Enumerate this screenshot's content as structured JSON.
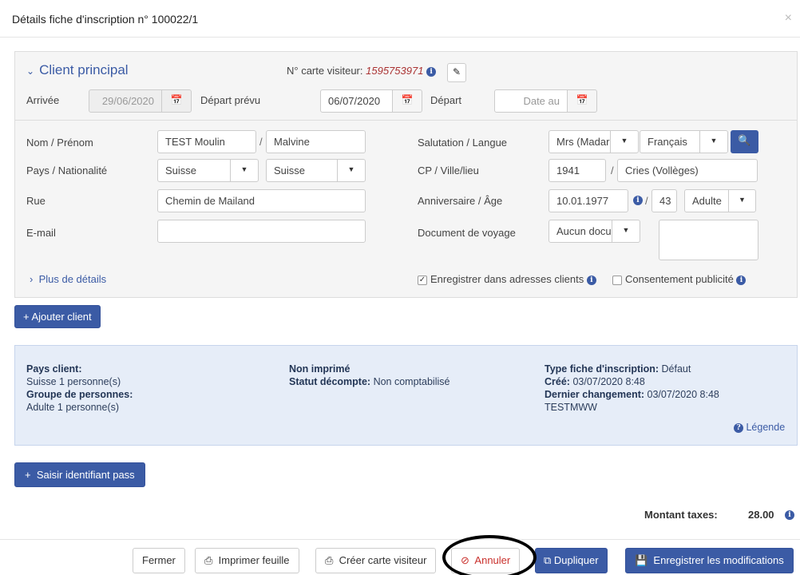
{
  "modal": {
    "title": "Détails fiche d'inscription n° 100022/1",
    "close": "×"
  },
  "client": {
    "section_title": "Client principal",
    "visitor_card_label": "N° carte visiteur:",
    "visitor_card_number": "1595753971",
    "arrival_label": "Arrivée",
    "arrival_value": "29/06/2020",
    "planned_departure_label": "Départ prévu",
    "planned_departure_value": "06/07/2020",
    "departure_label": "Départ",
    "departure_placeholder": "Date au",
    "name_label": "Nom / Prénom",
    "last_name": "TEST Moulin",
    "first_name": "Malvine",
    "country_label": "Pays / Nationalité",
    "country": "Suisse",
    "nationality": "Suisse",
    "street_label": "Rue",
    "street": "Chemin de Mailand",
    "email_label": "E-mail",
    "email": "",
    "salutation_label": "Salutation / Langue",
    "salutation": "Mrs (Madar",
    "language": "Français",
    "zip_label": "CP / Ville/lieu",
    "zip": "1941",
    "city": "Cries (Vollèges)",
    "birthday_label": "Anniversaire / Âge",
    "birthday": "10.01.1977",
    "age": "43",
    "age_category": "Adulte",
    "travel_doc_label": "Document de voyage",
    "travel_doc": "Aucun docum",
    "separator": "/",
    "more_details": "Plus de détails",
    "save_addresses_label": "Enregistrer dans adresses clients",
    "save_addresses_checked": true,
    "consent_label": "Consentement publicité",
    "consent_checked": false
  },
  "add_client_button": "Ajouter client",
  "summary": {
    "country_client_label": "Pays client:",
    "country_client_value": "Suisse 1 personne(s)",
    "group_label": "Groupe de personnes:",
    "group_value": "Adulte 1 personne(s)",
    "print_status": "Non imprimé",
    "count_status_label": "Statut décompte:",
    "count_status_value": "Non comptabilisé",
    "type_label": "Type fiche d'inscription:",
    "type_value": "Défaut",
    "created_label": "Créé:",
    "created_value": "03/07/2020 8:48",
    "last_change_label": "Dernier changement:",
    "last_change_value": "03/07/2020 8:48",
    "user": "TESTMWW",
    "legend": "Légende"
  },
  "pass_button": "Saisir identifiant pass",
  "tax": {
    "label": "Montant taxes:",
    "value": "28.00"
  },
  "footer": {
    "close": "Fermer",
    "print": "Imprimer feuille",
    "create_card": "Créer carte visiteur",
    "cancel": "Annuler",
    "duplicate": "Dupliquer",
    "save": "Enregistrer les modifications"
  },
  "colors": {
    "primary": "#3b5ba5",
    "danger": "#c9302c",
    "info_bg": "#e6edf8"
  }
}
